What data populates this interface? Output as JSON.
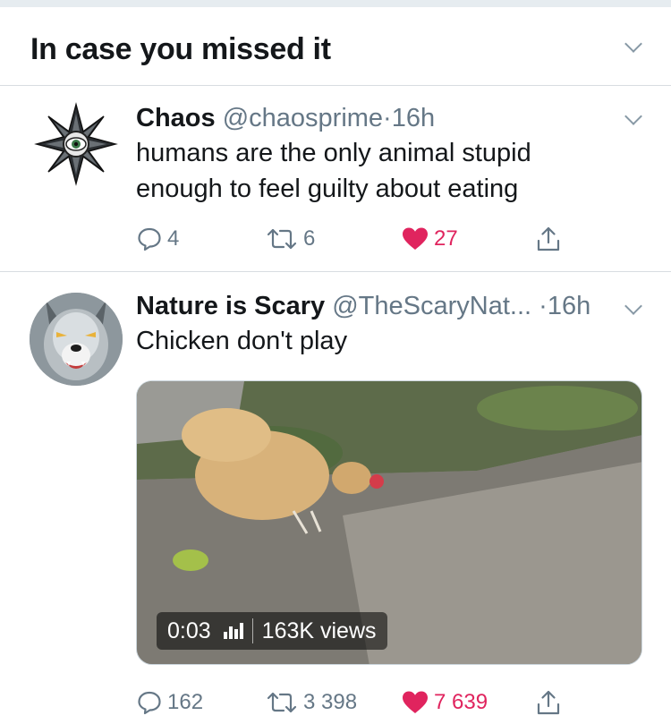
{
  "section": {
    "title": "In case you missed it"
  },
  "tweets": [
    {
      "name": "Chaos",
      "handle": "@chaosprime",
      "dot": "·",
      "time": "16h",
      "text": "humans are the only animal stupid enough to feel guilty about eating",
      "replies": "4",
      "retweets": "6",
      "likes": "27"
    },
    {
      "name": "Nature is Scary",
      "handle": "@TheScaryNat...",
      "dot": "·",
      "time": "16h",
      "text": "Chicken don't play",
      "video": {
        "duration": "0:03",
        "views": "163K views"
      },
      "replies": "162",
      "retweets": "3 398",
      "likes": "7 639"
    }
  ],
  "colors": {
    "like_active": "#e0245e",
    "secondary_text": "#657786",
    "divider": "#d8dde1"
  },
  "icons": [
    "chevron-down-icon",
    "reply-icon",
    "retweet-icon",
    "heart-icon",
    "share-icon",
    "views-bars-icon"
  ]
}
